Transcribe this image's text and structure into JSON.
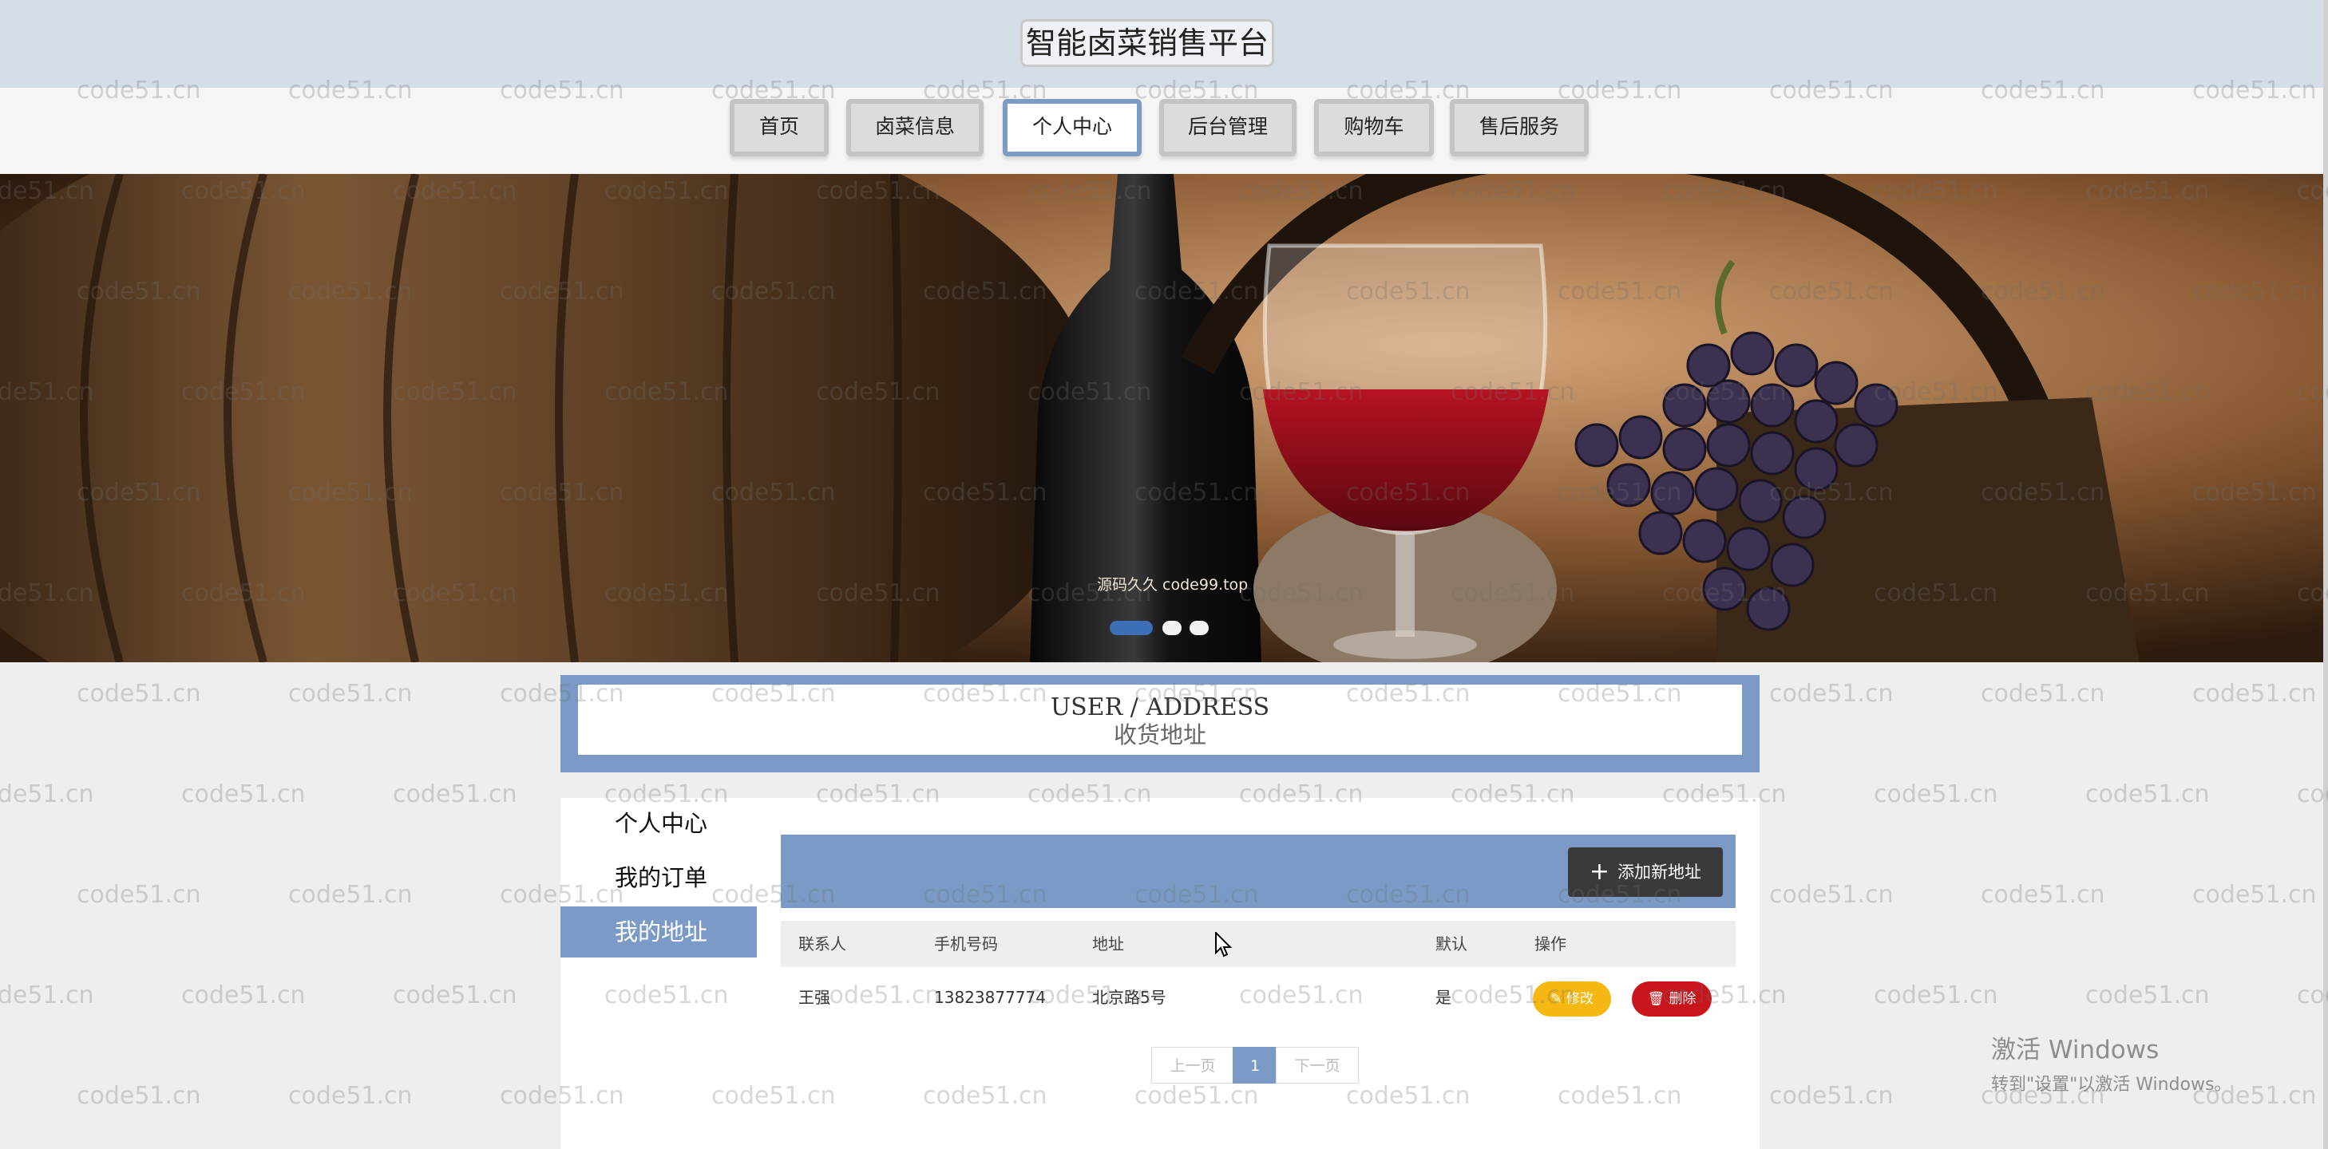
{
  "header": {
    "title": "智能卤菜销售平台"
  },
  "nav": {
    "items": [
      "首页",
      "卤菜信息",
      "个人中心",
      "后台管理",
      "购物车",
      "售后服务"
    ],
    "active_index": 2
  },
  "banner": {
    "caption": "源码久久 code99.top",
    "slide_count": 3,
    "active_slide": 1
  },
  "section": {
    "title_en": "USER / ADDRESS",
    "title_cn": "收货地址"
  },
  "sidebar": {
    "items": [
      "个人中心",
      "我的订单",
      "我的地址"
    ],
    "active_index": 2
  },
  "address_table": {
    "add_button": "添加新地址",
    "columns": [
      "联系人",
      "手机号码",
      "地址",
      "默认",
      "操作"
    ],
    "rows": [
      {
        "contact": "王强",
        "phone": "13823877774",
        "address": "北京路5号",
        "default": "是",
        "edit": "修改",
        "delete": "删除"
      }
    ]
  },
  "pagination": {
    "prev": "上一页",
    "current": "1",
    "next": "下一页"
  },
  "os_overlay": {
    "line1": "激活 Windows",
    "line2": "转到\"设置\"以激活 Windows。"
  },
  "watermark": {
    "text": "code51.cn"
  },
  "colors": {
    "accent": "#7b9bc6",
    "dark_button": "#3a3a3a",
    "edit": "#f5b812",
    "delete": "#c8141a",
    "header_bg": "#d5dde7"
  },
  "icons": {
    "add": "plus-icon",
    "edit": "pencil-icon",
    "delete": "trash-icon"
  }
}
